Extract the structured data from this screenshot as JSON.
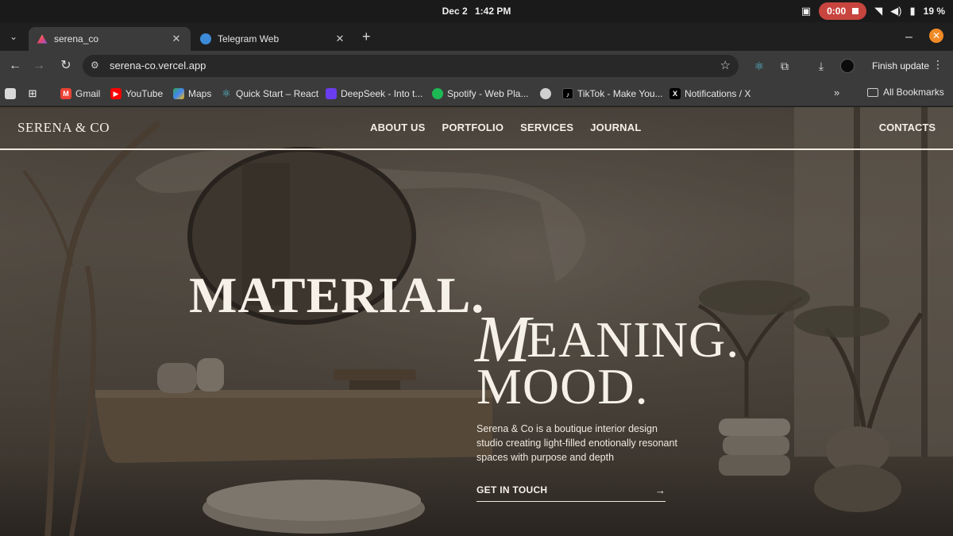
{
  "os": {
    "date": "Dec 2",
    "time": "1:42 PM",
    "recording_time": "0:00",
    "battery": "19 %"
  },
  "browser": {
    "tabs": [
      {
        "label": "serena_co"
      },
      {
        "label": "Telegram Web"
      }
    ],
    "new_tab": "+",
    "url": "serena-co.vercel.app",
    "finish_update": "Finish update",
    "bookmarks": [
      {
        "label": "Gmail"
      },
      {
        "label": "YouTube"
      },
      {
        "label": "Maps"
      },
      {
        "label": "Quick Start – React"
      },
      {
        "label": "DeepSeek - Into t..."
      },
      {
        "label": "Spotify - Web Pla..."
      },
      {
        "label": "TikTok - Make You..."
      },
      {
        "label": "Notifications / X"
      }
    ],
    "all_bookmarks": "All Bookmarks"
  },
  "site": {
    "logo": "SERENA & CO",
    "nav": [
      "ABOUT US",
      "PORTFOLIO",
      "SERVICES",
      "JOURNAL"
    ],
    "contacts": "CONTACTS",
    "hero": {
      "line1": "MATERIAL.",
      "line2_initial": "M",
      "line2_rest": "EANING.",
      "line3": "MOOD."
    },
    "tagline": "Serena & Co is a boutique interior design studio creating light-filled enotionally resonant spaces with purpose and depth",
    "cta": "GET IN TOUCH"
  },
  "colors": {
    "tab_active": "#3b3b3b",
    "record": "#c7453e",
    "hero_text": "#f6f1e8"
  }
}
